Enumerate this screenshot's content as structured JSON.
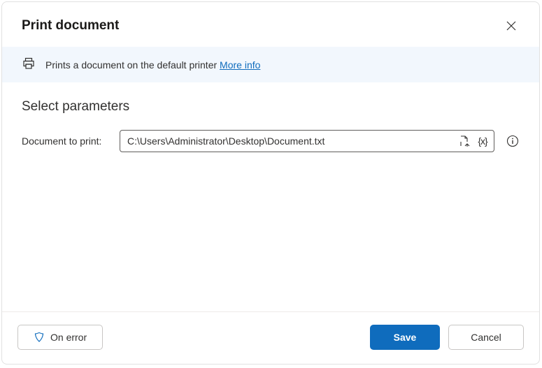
{
  "header": {
    "title": "Print document"
  },
  "banner": {
    "description": "Prints a document on the default printer ",
    "more_info": "More info"
  },
  "section": {
    "title": "Select parameters"
  },
  "params": {
    "document_label": "Document to print:",
    "document_value": "C:\\Users\\Administrator\\Desktop\\Document.txt"
  },
  "footer": {
    "on_error": "On error",
    "save": "Save",
    "cancel": "Cancel"
  }
}
